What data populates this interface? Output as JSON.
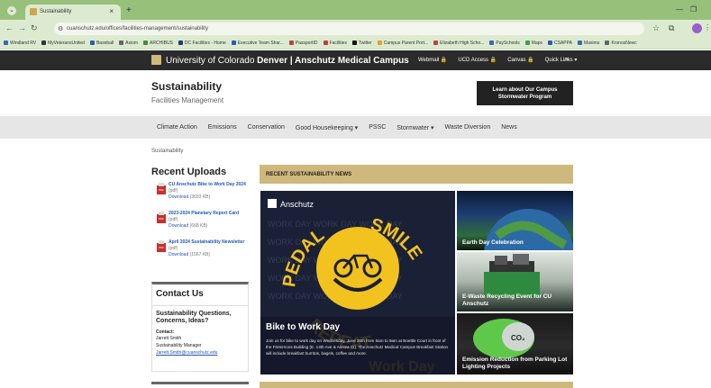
{
  "browser": {
    "tab_title": "Sustainability",
    "tab_close": "×",
    "new_tab": "+",
    "url": "cuanschutz.edu/offices/facilities-management/sustainability",
    "bookmarks": [
      {
        "label": "Windland RV",
        "color": "#3a6ab0"
      },
      {
        "label": "MyVeteransUnited",
        "color": "#333333"
      },
      {
        "label": "Baseball",
        "color": "#2a5bb5"
      },
      {
        "label": "Axiom",
        "color": "#666666"
      },
      {
        "label": "ARCHIBUS",
        "color": "#4a8a3a"
      },
      {
        "label": "DC Facilities - Home",
        "color": "#1f3d7a"
      },
      {
        "label": "Executive Team Shar...",
        "color": "#2a5bb5"
      },
      {
        "label": "PassportID",
        "color": "#c04040"
      },
      {
        "label": "Facilities",
        "color": "#c04040"
      },
      {
        "label": "Twitter",
        "color": "#111111"
      },
      {
        "label": "Campus Parent Port...",
        "color": "#e0a030"
      },
      {
        "label": "Elizabeth High Scho...",
        "color": "#c04040"
      },
      {
        "label": "PaySchools",
        "color": "#3a6ab0"
      },
      {
        "label": "Maps",
        "color": "#3aa050"
      },
      {
        "label": "CSAPPA",
        "color": "#2a5bb5"
      },
      {
        "label": "Maximo",
        "color": "#3a6ab0"
      },
      {
        "label": "KronosNewc",
        "color": "#666666"
      }
    ]
  },
  "site": {
    "brand_prefix": "University of Colorado ",
    "brand_bold": "Denver | Anschutz Medical Campus",
    "top_links": [
      "Webmail 🔒",
      "UCD Access 🔒",
      "Canvas 🔒",
      "Quick Links ▾"
    ],
    "title": "Sustainability",
    "subtitle": "Facilities Management",
    "cta_line1": "Learn about Our Campus",
    "cta_line2": "Stormwater Program",
    "nav": [
      "Climate Action",
      "Emissions",
      "Conservation",
      "Good Housekeeping ▾",
      "PSSC",
      "Stormwater ▾",
      "Waste Diversion",
      "News"
    ],
    "breadcrumb": "Sustainability"
  },
  "uploads": {
    "heading": "Recent Uploads",
    "items": [
      {
        "title": "CU Anschutz Bike to Work Day 2024",
        "type": "(pdf)",
        "download": "Download",
        "size": "(3693 KB)"
      },
      {
        "title": "2023-2024 Planetary Report Card",
        "type": "(pdf)",
        "download": "Download",
        "size": "(668 KB)"
      },
      {
        "title": "April 2024 Sustainability Newsletter",
        "type": "(pdf)",
        "download": "Download",
        "size": "(1567 KB)"
      }
    ],
    "pdf_label": "PDF"
  },
  "contact": {
    "heading": "Contact Us",
    "question": "Sustainability Questions, Concerns, Ideas?",
    "label": "Contact:",
    "name": "Jarrett Smith",
    "role": "Sustainability Manager",
    "email": "Jarrett.Smith@cuanschutz.edu"
  },
  "news": {
    "heading": "RECENT SUSTAINABILITY NEWS",
    "feature": {
      "brand": "Anschutz",
      "art_words": [
        "PEDAL",
        "SMILE",
        "REPEAT",
        "Work Day"
      ],
      "title": "Bike to Work Day",
      "text": "Join us for bike to work day on Wednesday, June 26th from 6am to 9am at Boettle Court in front of the Fitzsimons Building (E. 13th Ave & Aurora Ct). The Anschutz Medical Campus Breakfast Station will include breakfast burritos, bagels, coffee and more."
    },
    "tiles": [
      {
        "title": "Earth Day Celebration"
      },
      {
        "title": "E-Waste Recycling Event for CU Anschutz"
      },
      {
        "title": "Emission Reduction from Parking Lot Lighting Projects"
      }
    ]
  },
  "colors": {
    "gold": "#cfb87c",
    "dark": "#2b2b2b",
    "link": "#2356b8"
  }
}
